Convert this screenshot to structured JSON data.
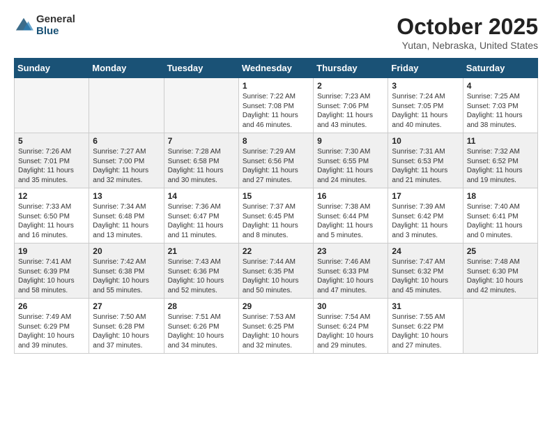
{
  "logo": {
    "general": "General",
    "blue": "Blue"
  },
  "title": "October 2025",
  "subtitle": "Yutan, Nebraska, United States",
  "days_of_week": [
    "Sunday",
    "Monday",
    "Tuesday",
    "Wednesday",
    "Thursday",
    "Friday",
    "Saturday"
  ],
  "weeks": [
    [
      {
        "day": "",
        "info": ""
      },
      {
        "day": "",
        "info": ""
      },
      {
        "day": "",
        "info": ""
      },
      {
        "day": "1",
        "info": "Sunrise: 7:22 AM\nSunset: 7:08 PM\nDaylight: 11 hours and 46 minutes."
      },
      {
        "day": "2",
        "info": "Sunrise: 7:23 AM\nSunset: 7:06 PM\nDaylight: 11 hours and 43 minutes."
      },
      {
        "day": "3",
        "info": "Sunrise: 7:24 AM\nSunset: 7:05 PM\nDaylight: 11 hours and 40 minutes."
      },
      {
        "day": "4",
        "info": "Sunrise: 7:25 AM\nSunset: 7:03 PM\nDaylight: 11 hours and 38 minutes."
      }
    ],
    [
      {
        "day": "5",
        "info": "Sunrise: 7:26 AM\nSunset: 7:01 PM\nDaylight: 11 hours and 35 minutes."
      },
      {
        "day": "6",
        "info": "Sunrise: 7:27 AM\nSunset: 7:00 PM\nDaylight: 11 hours and 32 minutes."
      },
      {
        "day": "7",
        "info": "Sunrise: 7:28 AM\nSunset: 6:58 PM\nDaylight: 11 hours and 30 minutes."
      },
      {
        "day": "8",
        "info": "Sunrise: 7:29 AM\nSunset: 6:56 PM\nDaylight: 11 hours and 27 minutes."
      },
      {
        "day": "9",
        "info": "Sunrise: 7:30 AM\nSunset: 6:55 PM\nDaylight: 11 hours and 24 minutes."
      },
      {
        "day": "10",
        "info": "Sunrise: 7:31 AM\nSunset: 6:53 PM\nDaylight: 11 hours and 21 minutes."
      },
      {
        "day": "11",
        "info": "Sunrise: 7:32 AM\nSunset: 6:52 PM\nDaylight: 11 hours and 19 minutes."
      }
    ],
    [
      {
        "day": "12",
        "info": "Sunrise: 7:33 AM\nSunset: 6:50 PM\nDaylight: 11 hours and 16 minutes."
      },
      {
        "day": "13",
        "info": "Sunrise: 7:34 AM\nSunset: 6:48 PM\nDaylight: 11 hours and 13 minutes."
      },
      {
        "day": "14",
        "info": "Sunrise: 7:36 AM\nSunset: 6:47 PM\nDaylight: 11 hours and 11 minutes."
      },
      {
        "day": "15",
        "info": "Sunrise: 7:37 AM\nSunset: 6:45 PM\nDaylight: 11 hours and 8 minutes."
      },
      {
        "day": "16",
        "info": "Sunrise: 7:38 AM\nSunset: 6:44 PM\nDaylight: 11 hours and 5 minutes."
      },
      {
        "day": "17",
        "info": "Sunrise: 7:39 AM\nSunset: 6:42 PM\nDaylight: 11 hours and 3 minutes."
      },
      {
        "day": "18",
        "info": "Sunrise: 7:40 AM\nSunset: 6:41 PM\nDaylight: 11 hours and 0 minutes."
      }
    ],
    [
      {
        "day": "19",
        "info": "Sunrise: 7:41 AM\nSunset: 6:39 PM\nDaylight: 10 hours and 58 minutes."
      },
      {
        "day": "20",
        "info": "Sunrise: 7:42 AM\nSunset: 6:38 PM\nDaylight: 10 hours and 55 minutes."
      },
      {
        "day": "21",
        "info": "Sunrise: 7:43 AM\nSunset: 6:36 PM\nDaylight: 10 hours and 52 minutes."
      },
      {
        "day": "22",
        "info": "Sunrise: 7:44 AM\nSunset: 6:35 PM\nDaylight: 10 hours and 50 minutes."
      },
      {
        "day": "23",
        "info": "Sunrise: 7:46 AM\nSunset: 6:33 PM\nDaylight: 10 hours and 47 minutes."
      },
      {
        "day": "24",
        "info": "Sunrise: 7:47 AM\nSunset: 6:32 PM\nDaylight: 10 hours and 45 minutes."
      },
      {
        "day": "25",
        "info": "Sunrise: 7:48 AM\nSunset: 6:30 PM\nDaylight: 10 hours and 42 minutes."
      }
    ],
    [
      {
        "day": "26",
        "info": "Sunrise: 7:49 AM\nSunset: 6:29 PM\nDaylight: 10 hours and 39 minutes."
      },
      {
        "day": "27",
        "info": "Sunrise: 7:50 AM\nSunset: 6:28 PM\nDaylight: 10 hours and 37 minutes."
      },
      {
        "day": "28",
        "info": "Sunrise: 7:51 AM\nSunset: 6:26 PM\nDaylight: 10 hours and 34 minutes."
      },
      {
        "day": "29",
        "info": "Sunrise: 7:53 AM\nSunset: 6:25 PM\nDaylight: 10 hours and 32 minutes."
      },
      {
        "day": "30",
        "info": "Sunrise: 7:54 AM\nSunset: 6:24 PM\nDaylight: 10 hours and 29 minutes."
      },
      {
        "day": "31",
        "info": "Sunrise: 7:55 AM\nSunset: 6:22 PM\nDaylight: 10 hours and 27 minutes."
      },
      {
        "day": "",
        "info": ""
      }
    ]
  ]
}
